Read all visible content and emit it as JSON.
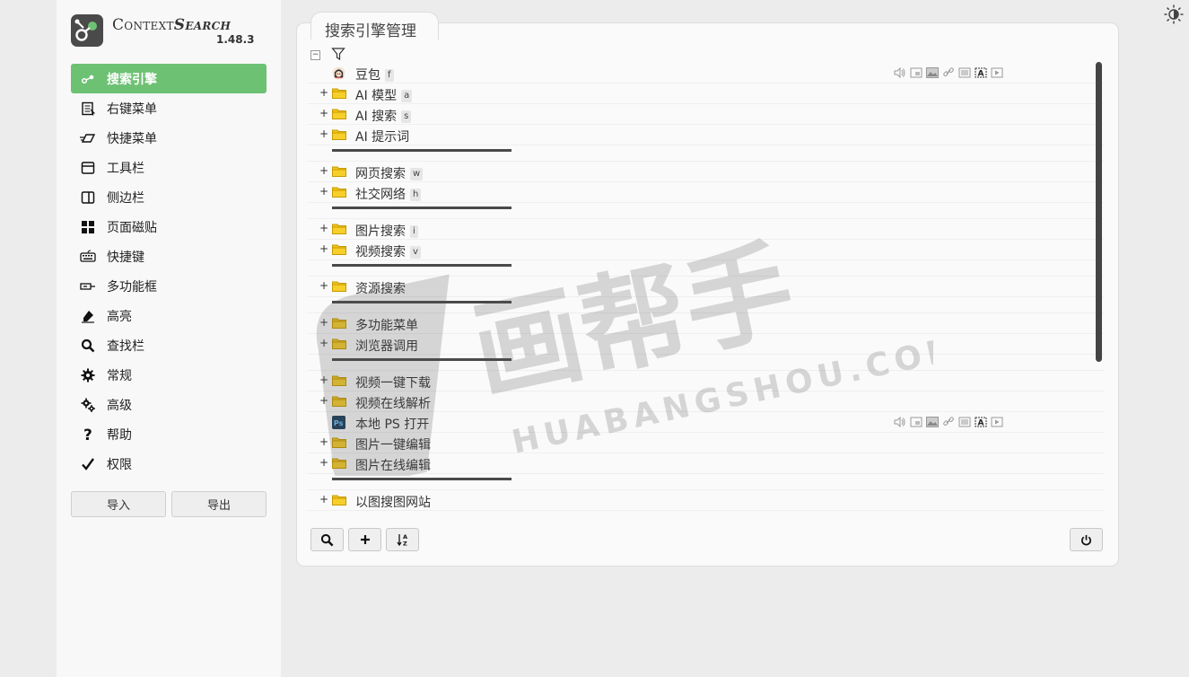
{
  "brand": {
    "title_a": "Context",
    "title_b": "Search",
    "version": "1.48.3"
  },
  "nav": [
    {
      "label": "搜索引擎",
      "icon": "search-engines-icon",
      "active": true
    },
    {
      "label": "右键菜单",
      "icon": "context-menu-icon"
    },
    {
      "label": "快捷菜单",
      "icon": "quick-menu-icon"
    },
    {
      "label": "工具栏",
      "icon": "toolbar-icon"
    },
    {
      "label": "侧边栏",
      "icon": "sidebar-icon"
    },
    {
      "label": "页面磁贴",
      "icon": "page-tiles-icon"
    },
    {
      "label": "快捷键",
      "icon": "keyboard-icon"
    },
    {
      "label": "多功能框",
      "icon": "omnibox-icon"
    },
    {
      "label": "高亮",
      "icon": "highlight-icon"
    },
    {
      "label": "查找栏",
      "icon": "find-bar-icon"
    },
    {
      "label": "常规",
      "icon": "gear-icon"
    },
    {
      "label": "高级",
      "icon": "advanced-gears-icon"
    },
    {
      "label": "帮助",
      "icon": "help-icon"
    },
    {
      "label": "权限",
      "icon": "check-icon"
    }
  ],
  "io": {
    "import_label": "导入",
    "export_label": "导出"
  },
  "panel": {
    "tab_label": "搜索引擎管理"
  },
  "tree": {
    "items": [
      {
        "type": "engine",
        "label": "豆包",
        "key": "f",
        "icon": "doubao-icon",
        "context_icons": true
      },
      {
        "type": "folder",
        "label": "AI 模型",
        "key": "a"
      },
      {
        "type": "folder",
        "label": "AI 搜索",
        "key": "s"
      },
      {
        "type": "folder",
        "label": "AI 提示词",
        "key": ""
      },
      {
        "type": "separator"
      },
      {
        "type": "folder",
        "label": "网页搜索",
        "key": "w"
      },
      {
        "type": "folder",
        "label": "社交网络",
        "key": "h"
      },
      {
        "type": "separator"
      },
      {
        "type": "folder",
        "label": "图片搜索",
        "key": "i"
      },
      {
        "type": "folder",
        "label": "视频搜索",
        "key": "v"
      },
      {
        "type": "separator"
      },
      {
        "type": "folder",
        "label": "资源搜索",
        "key": ""
      },
      {
        "type": "separator"
      },
      {
        "type": "folder",
        "label": "多功能菜单",
        "key": ""
      },
      {
        "type": "folder",
        "label": "浏览器调用",
        "key": ""
      },
      {
        "type": "separator"
      },
      {
        "type": "folder",
        "label": "视频一键下载",
        "key": ""
      },
      {
        "type": "folder",
        "label": "视频在线解析",
        "key": ""
      },
      {
        "type": "engine",
        "label": "本地 PS 打开",
        "key": "",
        "icon": "photoshop-icon",
        "context_icons": true
      },
      {
        "type": "folder",
        "label": "图片一键编辑",
        "key": ""
      },
      {
        "type": "folder",
        "label": "图片在线编辑",
        "key": ""
      },
      {
        "type": "separator"
      },
      {
        "type": "folder",
        "label": "以图搜图网站",
        "key": ""
      }
    ]
  },
  "toolbar": {
    "search_icon": "search-icon",
    "add_icon": "plus-icon",
    "sort_icon": "sort-az-icon",
    "power_icon": "power-icon"
  },
  "watermark": {
    "main": "画帮手",
    "sub": "HUABANGSHOU.COM"
  },
  "colors": {
    "accent": "#6dc173",
    "folder": "#f5c518",
    "folder_edge": "#c79a00"
  }
}
